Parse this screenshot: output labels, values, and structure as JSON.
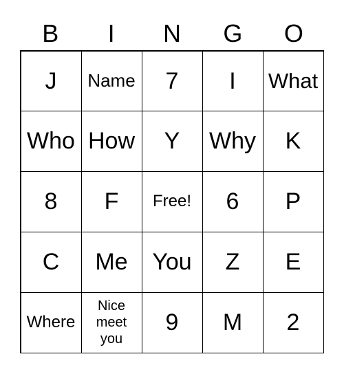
{
  "header": [
    "B",
    "I",
    "N",
    "G",
    "O"
  ],
  "cells": [
    [
      "J",
      "Name",
      "7",
      "I",
      "What"
    ],
    [
      "Who",
      "How",
      "Y",
      "Why",
      "K"
    ],
    [
      "8",
      "F",
      "Free!",
      "6",
      "P"
    ],
    [
      "C",
      "Me",
      "You",
      "Z",
      "E"
    ],
    [
      "Where",
      "Nice\nmeet\nyou",
      "9",
      "M",
      "2"
    ]
  ]
}
